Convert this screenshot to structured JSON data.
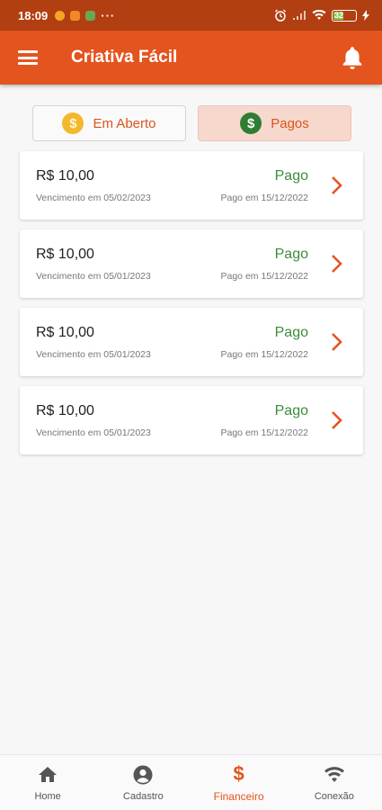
{
  "status_bar": {
    "time": "18:09",
    "battery": "32"
  },
  "app_bar": {
    "title": "Criativa Fácil"
  },
  "tabs": [
    {
      "label": "Em Aberto",
      "icon": "coin-icon",
      "coin_color": "#f3b92c",
      "active": false
    },
    {
      "label": "Pagos",
      "icon": "coin-icon",
      "coin_color": "#2e7d32",
      "active": true
    }
  ],
  "currency_symbol": "$",
  "invoices": [
    {
      "amount": "R$ 10,00",
      "due": "Vencimento em 05/02/2023",
      "status": "Pago",
      "paid_on": "Pago em 15/12/2022"
    },
    {
      "amount": "R$ 10,00",
      "due": "Vencimento em 05/01/2023",
      "status": "Pago",
      "paid_on": "Pago em 15/12/2022"
    },
    {
      "amount": "R$ 10,00",
      "due": "Vencimento em 05/01/2023",
      "status": "Pago",
      "paid_on": "Pago em 15/12/2022"
    },
    {
      "amount": "R$ 10,00",
      "due": "Vencimento em 05/01/2023",
      "status": "Pago",
      "paid_on": "Pago em 15/12/2022"
    }
  ],
  "bottom_nav": [
    {
      "label": "Home",
      "icon": "home-icon",
      "active": false
    },
    {
      "label": "Cadastro",
      "icon": "account-icon",
      "active": false
    },
    {
      "label": "Financeiro",
      "icon": "dollar-icon",
      "active": true
    },
    {
      "label": "Conexão",
      "icon": "wifi-icon",
      "active": false
    }
  ],
  "colors": {
    "primary": "#e4541e",
    "status_bar": "#b23f12",
    "paid_green": "#3c8c3c",
    "active_tab_bg": "#f7d8cd"
  }
}
